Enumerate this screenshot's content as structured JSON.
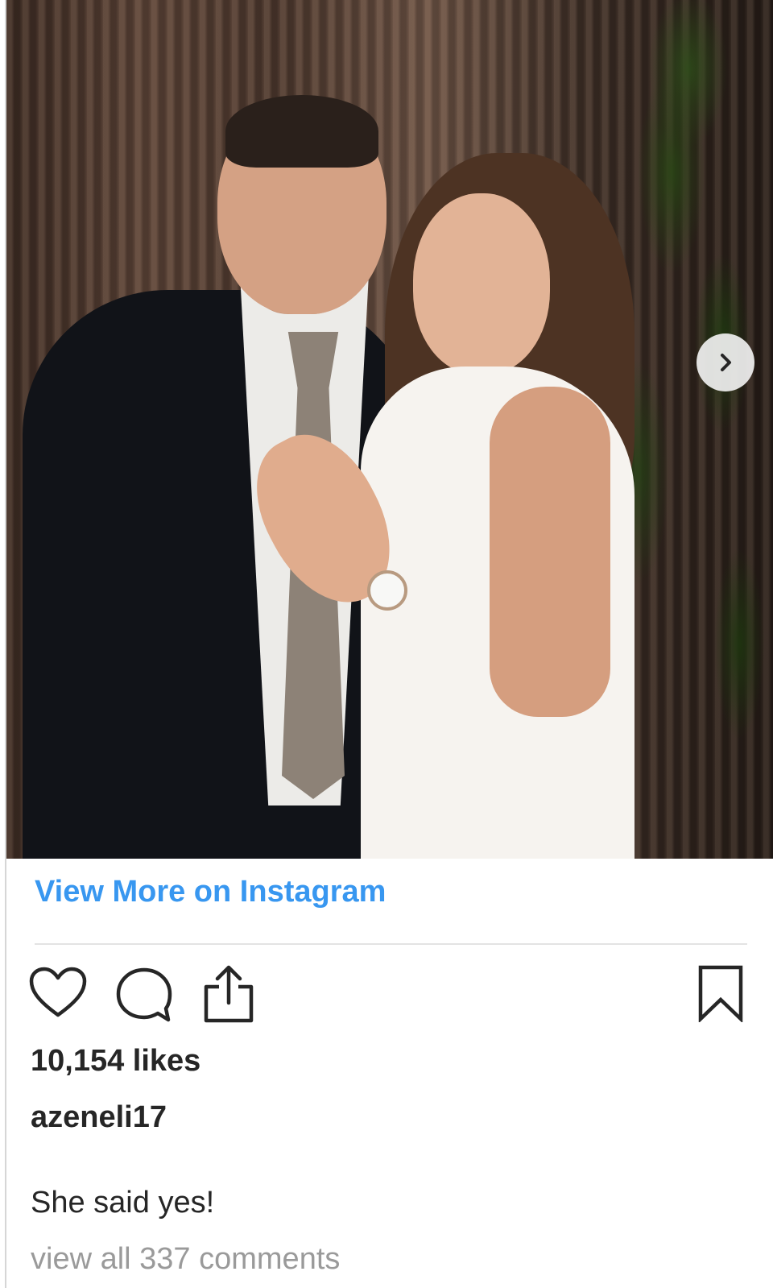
{
  "post": {
    "image_description_alt": "",
    "view_more_label": "View More on Instagram",
    "likes": "10,154 likes",
    "username": "azeneli17",
    "caption": "She said yes!",
    "view_comments": "view all 337 comments"
  },
  "icons": {
    "like": "heart-icon",
    "comment": "comment-icon",
    "share": "share-icon",
    "save": "bookmark-icon",
    "next": "chevron-right-icon"
  },
  "colors": {
    "link": "#3897f0",
    "text": "#262626",
    "muted": "#9a9a9a"
  }
}
